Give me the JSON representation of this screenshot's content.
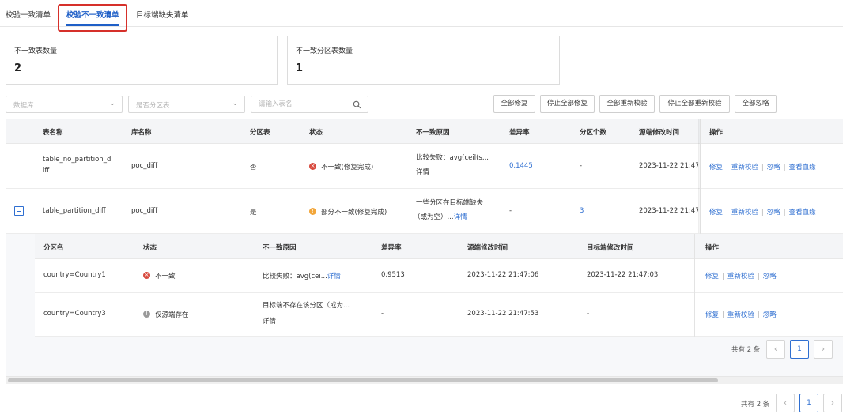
{
  "tabs": [
    {
      "label": "校验一致清单"
    },
    {
      "label": "校验不一致清单"
    },
    {
      "label": "目标端缺失清单"
    }
  ],
  "stats": [
    {
      "label": "不一致表数量",
      "value": "2"
    },
    {
      "label": "不一致分区表数量",
      "value": "1"
    }
  ],
  "filters": {
    "database_placeholder": "数据库",
    "partition_placeholder": "是否分区表",
    "table_search_placeholder": "请输入表名"
  },
  "actions": {
    "repair_all": "全部修复",
    "stop_repair_all": "停止全部修复",
    "recheck_all": "全部重新校验",
    "stop_recheck_all": "停止全部重新校验",
    "ignore_all": "全部忽略"
  },
  "main_table": {
    "headers": [
      "表名称",
      "库名称",
      "分区表",
      "状态",
      "不一致原因",
      "差异率",
      "分区个数",
      "源端修改时间",
      "操作"
    ],
    "rows": [
      {
        "table_name_line1": "table_no_partition_d",
        "table_name_line2": "iff",
        "db": "poc_diff",
        "partitioned": "否",
        "status": "不一致(修复完成)",
        "reason_line1": "比较失败：avg(ceil(s...",
        "reason_detail": "详情",
        "diff_rate": "0.1445",
        "partition_count": "-",
        "src_time": "2023-11-22 21:47"
      },
      {
        "table_name_line1": "table_partition_diff",
        "db": "poc_diff",
        "partitioned": "是",
        "status": "部分不一致(修复完成)",
        "reason_line1": "一些分区在目标端缺失",
        "reason_line2": "（或为空）...",
        "reason_detail": "详情",
        "diff_rate": "-",
        "partition_count": "3",
        "src_time": "2023-11-22 21:47"
      }
    ],
    "op_links": {
      "repair": "修复",
      "recheck": "重新校验",
      "ignore": "忽略",
      "lineage": "查看血缘"
    }
  },
  "sub_table": {
    "headers": [
      "分区名",
      "状态",
      "不一致原因",
      "差异率",
      "源端修改时间",
      "目标端修改时间",
      "操作"
    ],
    "rows": [
      {
        "partition": "country=Country1",
        "status": "不一致",
        "reason_line1": "比较失败：avg(cei...",
        "reason_detail": "详情",
        "diff_rate": "0.9513",
        "src_time": "2023-11-22 21:47:06",
        "dst_time": "2023-11-22 21:47:03"
      },
      {
        "partition": "country=Country3",
        "status": "仅源端存在",
        "reason_line1": "目标端不存在该分区（或为...",
        "reason_detail": "详情",
        "diff_rate": "-",
        "src_time": "2023-11-22 21:47:53",
        "dst_time": "-"
      }
    ],
    "op_links": {
      "repair": "修复",
      "recheck": "重新校验",
      "ignore": "忽略"
    }
  },
  "pagination": {
    "sub_total": "共有 2 条",
    "sub_page": "1",
    "main_total": "共有 2 条",
    "main_page": "1"
  },
  "colors": {
    "accent": "#2f6fd1",
    "highlight": "#d6302a",
    "error": "#d84a3e",
    "warning": "#f2a63a"
  }
}
